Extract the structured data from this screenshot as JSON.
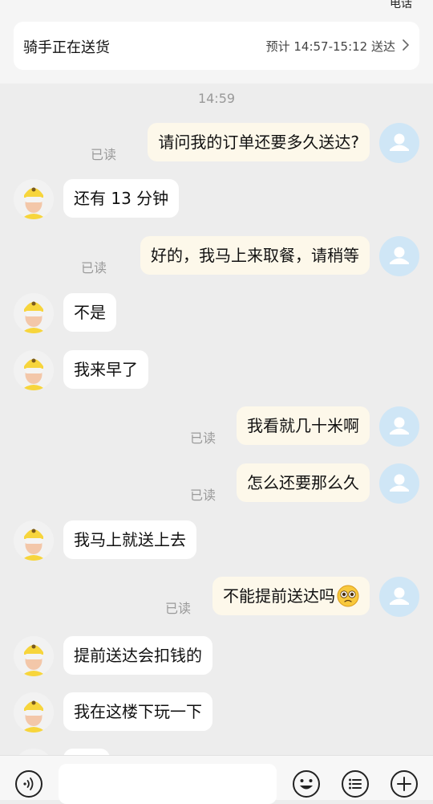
{
  "header": {
    "phone_label": "电话",
    "status_title": "骑手正在送货",
    "eta": "预计 14:57-15:12 送达"
  },
  "chat": {
    "time": "14:59",
    "read_label": "已读",
    "messages": [
      {
        "from": "me",
        "text": "请问我的订单还要多久送达?",
        "read": "已读"
      },
      {
        "from": "rider",
        "text": "还有 13 分钟"
      },
      {
        "from": "me",
        "text": "好的，我马上来取餐，请稍等",
        "read": "已读"
      },
      {
        "from": "rider",
        "text": "不是"
      },
      {
        "from": "rider",
        "text": "我来早了"
      },
      {
        "from": "me",
        "text": "我看就几十米啊",
        "read": "已读"
      },
      {
        "from": "me",
        "text": "怎么还要那么久",
        "read": "已读"
      },
      {
        "from": "rider",
        "text": "我马上就送上去"
      },
      {
        "from": "me",
        "text": "不能提前送达吗",
        "read": "已读",
        "emoji": "pleading-face-emoji"
      },
      {
        "from": "rider",
        "text": "提前送达会扣钱的"
      },
      {
        "from": "rider",
        "text": "我在这楼下玩一下"
      }
    ]
  },
  "bottom_bar": {
    "icons": [
      "voice-icon",
      "emoji-face-icon",
      "list-menu-icon",
      "plus-icon"
    ]
  },
  "colors": {
    "background": "#ededed",
    "rider_bubble": "#ffffff",
    "my_bubble": "#fdf8ea",
    "user_avatar": "#cfe6f6",
    "rider_helmet": "#f7d53c"
  }
}
